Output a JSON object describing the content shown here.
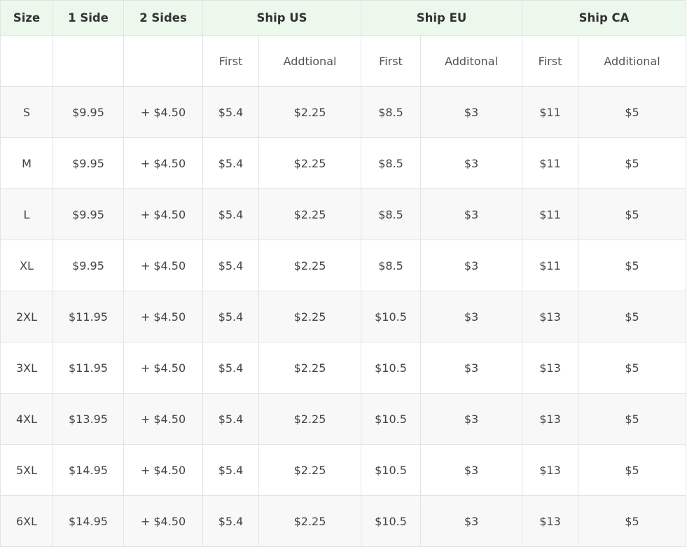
{
  "header": {
    "size": "Size",
    "one_side": "1 Side",
    "two_sides": "2 Sides",
    "ship_us": "Ship US",
    "ship_eu": "Ship EU",
    "ship_ca": "Ship CA"
  },
  "subheader": {
    "us_first": "First",
    "us_additional": "Addtional",
    "eu_first": "First",
    "eu_additional": "Additonal",
    "ca_first": "First",
    "ca_additional": "Additional"
  },
  "rows": [
    {
      "size": "S",
      "one_side": "$9.95",
      "two_sides": "+ $4.50",
      "us_first": "$5.4",
      "us_additional": "$2.25",
      "eu_first": "$8.5",
      "eu_additional": "$3",
      "ca_first": "$11",
      "ca_additional": "$5"
    },
    {
      "size": "M",
      "one_side": "$9.95",
      "two_sides": "+ $4.50",
      "us_first": "$5.4",
      "us_additional": "$2.25",
      "eu_first": "$8.5",
      "eu_additional": "$3",
      "ca_first": "$11",
      "ca_additional": "$5"
    },
    {
      "size": "L",
      "one_side": "$9.95",
      "two_sides": "+ $4.50",
      "us_first": "$5.4",
      "us_additional": "$2.25",
      "eu_first": "$8.5",
      "eu_additional": "$3",
      "ca_first": "$11",
      "ca_additional": "$5"
    },
    {
      "size": "XL",
      "one_side": "$9.95",
      "two_sides": "+ $4.50",
      "us_first": "$5.4",
      "us_additional": "$2.25",
      "eu_first": "$8.5",
      "eu_additional": "$3",
      "ca_first": "$11",
      "ca_additional": "$5"
    },
    {
      "size": "2XL",
      "one_side": "$11.95",
      "two_sides": "+ $4.50",
      "us_first": "$5.4",
      "us_additional": "$2.25",
      "eu_first": "$10.5",
      "eu_additional": "$3",
      "ca_first": "$13",
      "ca_additional": "$5"
    },
    {
      "size": "3XL",
      "one_side": "$11.95",
      "two_sides": "+ $4.50",
      "us_first": "$5.4",
      "us_additional": "$2.25",
      "eu_first": "$10.5",
      "eu_additional": "$3",
      "ca_first": "$13",
      "ca_additional": "$5"
    },
    {
      "size": "4XL",
      "one_side": "$13.95",
      "two_sides": "+ $4.50",
      "us_first": "$5.4",
      "us_additional": "$2.25",
      "eu_first": "$10.5",
      "eu_additional": "$3",
      "ca_first": "$13",
      "ca_additional": "$5"
    },
    {
      "size": "5XL",
      "one_side": "$14.95",
      "two_sides": "+ $4.50",
      "us_first": "$5.4",
      "us_additional": "$2.25",
      "eu_first": "$10.5",
      "eu_additional": "$3",
      "ca_first": "$13",
      "ca_additional": "$5"
    },
    {
      "size": "6XL",
      "one_side": "$14.95",
      "two_sides": "+ $4.50",
      "us_first": "$5.4",
      "us_additional": "$2.25",
      "eu_first": "$10.5",
      "eu_additional": "$3",
      "ca_first": "$13",
      "ca_additional": "$5"
    }
  ],
  "colors": {
    "header_bg": "#edf8ec",
    "row_alt_bg": "#f8f8f8",
    "border": "#e3e3e3",
    "text": "#444444"
  }
}
